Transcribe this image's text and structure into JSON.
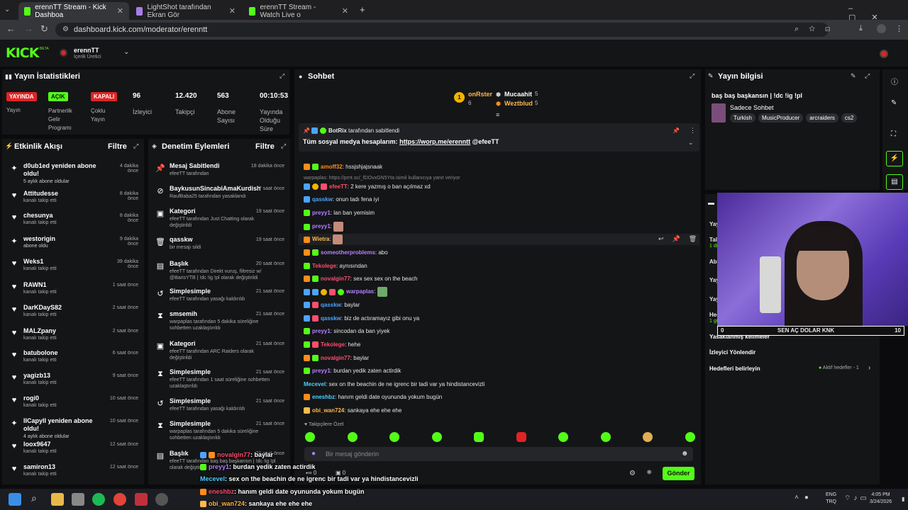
{
  "browser": {
    "tabs": [
      {
        "label": "erennTT Stream - Kick Dashboa"
      },
      {
        "label": "LightShot tarafından Ekran Gör"
      },
      {
        "label": "erennTT Stream - Watch Live o"
      }
    ],
    "url": "dashboard.kick.com/moderator/erenntt"
  },
  "header": {
    "logo": "KICK",
    "beta": "BETA",
    "channel": "erennTT",
    "role": "İçerik Üretici"
  },
  "stats": {
    "title": "Yayın İstatistikleri",
    "items": [
      {
        "badge": "YAYINDA",
        "label": "Yayın",
        "color": "#e02424"
      },
      {
        "badge": "AÇIK",
        "label": "Partnerlik Gelir Programı",
        "color": "#53fc18"
      },
      {
        "badge": "KAPALI",
        "label": "Çoklu Yayın",
        "color": "#e02424"
      }
    ],
    "numbers": [
      {
        "value": "96",
        "label": "İzleyici"
      },
      {
        "value": "12.420",
        "label": "Takipçi"
      },
      {
        "value": "563",
        "label": "Abone Sayısı"
      },
      {
        "value": "00:10:53",
        "label": "Yayında Olduğu Süre"
      }
    ]
  },
  "activity": {
    "title": "Etkinlik Akışı",
    "filter": "Filtre",
    "items": [
      {
        "name": "d0ub1ed yeniden abone oldu!",
        "desc": "5 aylık abone oldular",
        "time": "4 dakika önce",
        "icon": "✦"
      },
      {
        "name": "Attitudesse",
        "desc": "kanalı takip etti",
        "time": "8 dakika önce",
        "icon": "♥"
      },
      {
        "name": "chesunya",
        "desc": "kanalı takip etti",
        "time": "8 dakika önce",
        "icon": "♥"
      },
      {
        "name": "westorigin",
        "desc": "abone oldu",
        "time": "9 dakika önce",
        "icon": "✦"
      },
      {
        "name": "Weks1",
        "desc": "kanalı takip etti",
        "time": "39 dakika önce",
        "icon": "♥"
      },
      {
        "name": "RAWN1",
        "desc": "kanalı takip etti",
        "time": "1 saat önce",
        "icon": "♥"
      },
      {
        "name": "DarKDayS82",
        "desc": "kanalı takip etti",
        "time": "2 saat önce",
        "icon": "♥"
      },
      {
        "name": "MALZpany",
        "desc": "kanalı takip etti",
        "time": "2 saat önce",
        "icon": "♥"
      },
      {
        "name": "batubolone",
        "desc": "kanalı takip etti",
        "time": "6 saat önce",
        "icon": "♥"
      },
      {
        "name": "yagizb13",
        "desc": "kanalı takip etti",
        "time": "9 saat önce",
        "icon": "♥"
      },
      {
        "name": "rogi0",
        "desc": "kanalı takip etti",
        "time": "10 saat önce",
        "icon": "♥"
      },
      {
        "name": "IICapyII yeniden abone oldu!",
        "desc": "4 aylık abone oldular",
        "time": "10 saat önce",
        "icon": "✦"
      },
      {
        "name": "loox9647",
        "desc": "kanalı takip etti",
        "time": "12 saat önce",
        "icon": "♥"
      },
      {
        "name": "samiron13",
        "desc": "kanalı takip etti",
        "time": "12 saat önce",
        "icon": "♥"
      }
    ]
  },
  "moderation": {
    "title": "Denetim Eylemleri",
    "filter": "Filtre",
    "items": [
      {
        "name": "Mesaj Sabitlendi",
        "desc": "efeeTT tarafından",
        "time": "18 dakika önce",
        "icon": "📌"
      },
      {
        "name": "BaykusunSincabiAmaKurdish",
        "desc": "RaufBaba25 tarafından yasaklandı",
        "time": "17 saat önce",
        "icon": "⊘"
      },
      {
        "name": "Kategori",
        "desc": "efeeTT tarafından Just Chatting olarak değiştirildi",
        "time": "19 saat önce",
        "icon": "▣"
      },
      {
        "name": "qasskw",
        "desc": "bir mesajı sildi",
        "time": "19 saat önce",
        "icon": "🗑"
      },
      {
        "name": "Başlık",
        "desc": "efeeTT tarafından Direkt vuruş, filtresiz w/ @BarisYTB | !dc !ig !pl olarak değiştirildi",
        "time": "20 saat önce",
        "icon": "▤"
      },
      {
        "name": "Simplesimple",
        "desc": "efeeTT tarafından yasağı kaldırıldı",
        "time": "21 saat önce",
        "icon": "↺"
      },
      {
        "name": "smsemih",
        "desc": "warpaplas tarafından 5 dakika süreliğine sohbetten uzaklaştırıldı",
        "time": "21 saat önce",
        "icon": "⧗"
      },
      {
        "name": "Kategori",
        "desc": "efeeTT tarafından ARC Raiders olarak değiştirildi",
        "time": "21 saat önce",
        "icon": "▣"
      },
      {
        "name": "Simplesimple",
        "desc": "efeeTT tarafından 1 saat süreliğine sohbetten uzaklaştırıldı",
        "time": "21 saat önce",
        "icon": "⧗"
      },
      {
        "name": "Simplesimple",
        "desc": "efeeTT tarafından yasağı kaldırıldı",
        "time": "21 saat önce",
        "icon": "↺"
      },
      {
        "name": "Simplesimple",
        "desc": "warpaplas tarafından 5 dakika süreliğine sohbetten uzaklaştırıldı",
        "time": "21 saat önce",
        "icon": "⧗"
      },
      {
        "name": "Başlık",
        "desc": "efeeTT tarafından baş baş başkansın | !dc !ig !pl olarak değiştirildi",
        "time": "21 saat önce",
        "icon": "▤"
      }
    ]
  },
  "chat": {
    "title": "Sohbet",
    "leaders": [
      {
        "name": "onRster",
        "count": "6"
      },
      {
        "name": "Mucaahit",
        "count": "5"
      },
      {
        "name": "Weztblud",
        "count": "5"
      }
    ],
    "pinned": {
      "by": "BotRix",
      "suffix": "tarafından sabitlendi",
      "text": "Tüm sosyal medya hesaplarım:",
      "link": "https://worp.me/erenntt",
      "tail": "@efeeTT"
    },
    "reply": "warpaplas: https://prnt.sc/_fDOvxGN5Yta isimli kullanıcıya yanıt veriyor",
    "messages": [
      {
        "user": "amoff32",
        "text": ": hssjshjajsnaak",
        "color": "#ff8c1a"
      },
      {
        "user": "efeeTT",
        "text": ": 2 kere yazmış o ban açılmaz xd",
        "color": "#ff4d6d"
      },
      {
        "user": "qasskw",
        "text": ": onun tadı fena iyi",
        "color": "#4da3ff"
      },
      {
        "user": "preyy1",
        "text": ": lan ban yemisim",
        "color": "#b580ff"
      },
      {
        "user": "preyy1",
        "text": ":",
        "color": "#b580ff"
      },
      {
        "user": "Wietra",
        "text": ":",
        "color": "#ffb84d"
      },
      {
        "user": "someotherproblems",
        "text": ": abo",
        "color": "#b580ff"
      },
      {
        "user": "Tekolege",
        "text": ": aynısından",
        "color": "#ff4d6d"
      },
      {
        "user": "novalgin77",
        "text": ": sex sex sex on the beach",
        "color": "#ff4d6d"
      },
      {
        "user": "warpaplas",
        "text": ":",
        "color": "#b580ff"
      },
      {
        "user": "qasskw",
        "text": ": baylar",
        "color": "#4da3ff"
      },
      {
        "user": "qasskw",
        "text": ": biz de actıramayız gibi onu ya",
        "color": "#4da3ff"
      },
      {
        "user": "preyy1",
        "text": ": sincodan da ban yiyek",
        "color": "#b580ff"
      },
      {
        "user": "Tekolege",
        "text": ": hehe",
        "color": "#ff4d6d"
      },
      {
        "user": "novalgin77",
        "text": ": baylar",
        "color": "#ff4d6d"
      },
      {
        "user": "preyy1",
        "text": ": burdan yedik zaten actirdik",
        "color": "#b580ff"
      },
      {
        "user": "Mecevel",
        "text": ": sex on the beachin de ne igrenc bir tadi var ya hindistancevizli",
        "color": "#4dd0ff"
      },
      {
        "user": "eneshbz",
        "text": ": hanım geldi date oyununda yokum bugün",
        "color": "#4dd0ff"
      },
      {
        "user": "obi_wan724",
        "text": ": sankaya ehe ehe ehe",
        "color": "#ffb84d"
      }
    ],
    "followers_only": "Takipçilere Özel",
    "input_placeholder": "Bir mesaj gönderin",
    "send": "Gönder",
    "counter_a": "0",
    "counter_b": "0"
  },
  "info": {
    "title": "Yayın bilgisi",
    "stream_title": "baş baş başkansın | !dc !ig !pl",
    "mode": "Sadece Sohbet",
    "tags": [
      "Turkish",
      "MusicProducer",
      "arcraiders",
      "cs2"
    ],
    "menu": [
      "İzleyici Yönlendir",
      "Hedefleri belirleyin"
    ],
    "active_goals": "Aktif hedefler - 1",
    "partial": [
      "Yay",
      "Tal",
      "1 di",
      "Ab",
      "Yay",
      "Yay",
      "Hed",
      "1 gün",
      "Yasaklanmış kelimeler"
    ]
  },
  "overlay": {
    "goal_left": "0",
    "goal_text": "SEN AÇ DOLAR KNK",
    "goal_right": "10",
    "lines": [
      {
        "user": "novalgin77",
        "text": ": baylar",
        "color": "#ff4d6d"
      },
      {
        "user": "preyy1",
        "text": ": burdan yedik zaten actirdik",
        "color": "#b580ff"
      },
      {
        "user": "Mecevel",
        "text": ": sex on the beachin de ne igrenc bir tadi var ya hindistancevizli",
        "color": "#4dd0ff"
      },
      {
        "user": "eneshbz",
        "text": ": hanım geldi date oyununda yokum bugün",
        "color": "#ff4d6d"
      },
      {
        "user": "obi_wan724",
        "text": ": sankaya ehe ehe ehe",
        "color": "#ffb84d"
      }
    ]
  },
  "taskbar": {
    "lang1": "ENG",
    "lang2": "TRQ",
    "time": "4:05 PM",
    "date": "3/24/2026"
  }
}
